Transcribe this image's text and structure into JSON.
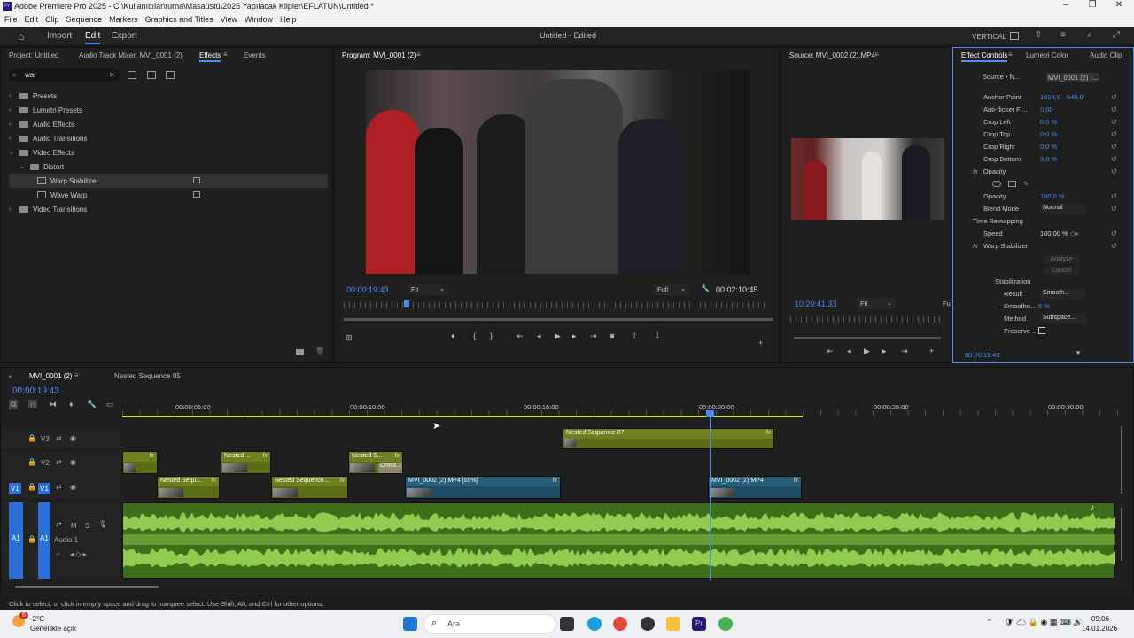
{
  "window": {
    "title": "Adobe Premiere Pro 2025 - C:\\Kullanıcılar\\turna\\Masaüstü\\2025 Yapılacak Klipler\\EFLATUN\\Untitled *"
  },
  "menu": [
    "File",
    "Edit",
    "Clip",
    "Sequence",
    "Markers",
    "Graphics and Titles",
    "View",
    "Window",
    "Help"
  ],
  "header": {
    "import": "Import",
    "edit": "Edit",
    "export": "Export",
    "project_title": "Untitled",
    "status": "- Edited",
    "workspace": "VERTICAL"
  },
  "left_panel": {
    "tabs": [
      "Project: Untitled",
      "Audio Track Mixer: MVI_0001 (2)",
      "Effects",
      "Events"
    ],
    "search_value": "war",
    "tree": [
      {
        "label": "Presets",
        "level": 0,
        "expand": "›"
      },
      {
        "label": "Lumetri Presets",
        "level": 0,
        "expand": "›"
      },
      {
        "label": "Audio Effects",
        "level": 0,
        "expand": "›"
      },
      {
        "label": "Audio Transitions",
        "level": 0,
        "expand": "›"
      },
      {
        "label": "Video Effects",
        "level": 0,
        "expand": "⌄"
      },
      {
        "label": "Distort",
        "level": 1,
        "expand": "⌄"
      },
      {
        "label": "Warp Stabilizer",
        "level": 2,
        "expand": "",
        "selected": true
      },
      {
        "label": "Wave Warp",
        "level": 2,
        "expand": ""
      },
      {
        "label": "Video Transitions",
        "level": 0,
        "expand": "›"
      }
    ]
  },
  "program": {
    "tab": "Program: MVI_0001 (2)",
    "timecode": "00:00:19:43",
    "fit": "Fit",
    "quality": "Full",
    "duration": "00:02:10:45"
  },
  "source": {
    "tab": "Source: MVI_0002 (2).MP4",
    "timecode": "10:20:41:33",
    "fit": "Fit",
    "quality": "Fu"
  },
  "effect_controls": {
    "tabs": [
      "Effect Controls",
      "Lumetri Color",
      "Audio Clip"
    ],
    "source_label": "Source • N...",
    "clip_label": "MVI_0001 (2) -...",
    "rows": [
      {
        "label": "Anchor Point",
        "value": "1024,0",
        "value2": "540,0",
        "indent": 2
      },
      {
        "label": "Anti-flicker Fi...",
        "value": "0,00",
        "indent": 1
      },
      {
        "label": "Crop Left",
        "value": "0,0 %",
        "indent": 1
      },
      {
        "label": "Crop Top",
        "value": "0,0 %",
        "indent": 1
      },
      {
        "label": "Crop Right",
        "value": "0,0 %",
        "indent": 1
      },
      {
        "label": "Crop Bottom",
        "value": "0,0 %",
        "indent": 1
      },
      {
        "label": "Opacity",
        "value": "",
        "indent": 0,
        "fx": true
      },
      {
        "label": "",
        "value": "",
        "indent": 1,
        "masks": true
      },
      {
        "label": "Opacity",
        "value": "100,0 %",
        "indent": 1
      },
      {
        "label": "Blend Mode",
        "value": "",
        "indent": 2,
        "dropdown": "Normal"
      },
      {
        "label": "Time Remapping",
        "value": "",
        "indent": 0
      },
      {
        "label": "Speed",
        "value": "100,00 %",
        "indent": 1
      },
      {
        "label": "Warp Stabilizer",
        "value": "",
        "indent": 0,
        "fx": true
      }
    ],
    "analyze": "Analyze",
    "cancel": "Cancel",
    "stabilization": "Stabilization",
    "result_label": "Result",
    "result_value": "Smooth...",
    "smoothness_label": "Smoothn...",
    "smoothness_value": "6 %",
    "method_label": "Method",
    "method_value": "Subspace...",
    "preserve_label": "Preserve ...",
    "footer_time": "00:00:19:43"
  },
  "timeline": {
    "tabs": [
      "MVI_0001 (2)",
      "Nested Sequence 05"
    ],
    "timecode": "00:00:19:43",
    "ruler": [
      "00:00:05:00",
      "00:00:10:00",
      "00:00:15:00",
      "00:00:20:00",
      "00:00:25:00",
      "00:00:30:00"
    ],
    "tracks": {
      "v3": "V3",
      "v2": "V2",
      "v1": "V1",
      "a1": "A1",
      "audio_name": "Audio 1",
      "m": "M",
      "s": "S"
    },
    "clips": [
      {
        "label": "",
        "fx": "fx"
      },
      {
        "label": "Nested ...",
        "fx": "fx"
      },
      {
        "label": "Nested S...",
        "fx": "fx"
      },
      {
        "label": "Cross...",
        "fx": ""
      },
      {
        "label": "Nested Sequ...",
        "fx": "fx"
      },
      {
        "label": "Nested Sequence...",
        "fx": "fx"
      },
      {
        "label": "MVI_0002 (2).MP4 [55%]",
        "fx": "fx"
      },
      {
        "label": "MVI_0002 (2).MP4",
        "fx": "fx"
      },
      {
        "label": "Nested Sequence 07",
        "fx": "fx"
      }
    ]
  },
  "status_bar": "Click to select, or click in empty space and drag to marquee select. Use Shift, Alt, and Ctrl for other options.",
  "taskbar": {
    "temp": "-2°C",
    "weather": "Genellikle açık",
    "search": "Ara",
    "time": "09:06",
    "date": "14.01.2026",
    "badge": "6"
  },
  "colors": {
    "accent": "#4d8cf5",
    "olive_clip": "#5a6b17",
    "teal_clip": "#1d4e66",
    "audio": "#3f6e1b",
    "waveform": "#8fcc4f"
  }
}
